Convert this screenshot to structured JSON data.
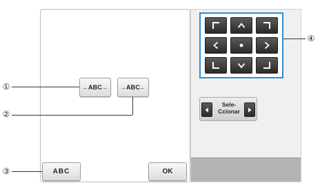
{
  "callouts": {
    "c1": "①",
    "c2": "②",
    "c3": "③",
    "c4": "④"
  },
  "buttons": {
    "abc_expand": {
      "left_sym": "←",
      "text": "ABC",
      "right_sym": "→"
    },
    "abc_condense": {
      "left_sym": "→",
      "text": "ABC",
      "right_sym": "←"
    },
    "abc_bottom": "ABC",
    "ok": "OK"
  },
  "select": {
    "label": "Sele-\nCcionar"
  },
  "pad_icons": [
    "corner-top-left-icon",
    "arrow-up-icon",
    "corner-top-right-icon",
    "arrow-left-icon",
    "center-dot-icon",
    "arrow-right-icon",
    "corner-bottom-left-icon",
    "arrow-down-icon",
    "corner-bottom-right-icon"
  ],
  "colors": {
    "highlight": "#2b8fd6",
    "pad_button": "#3a3a3a"
  }
}
